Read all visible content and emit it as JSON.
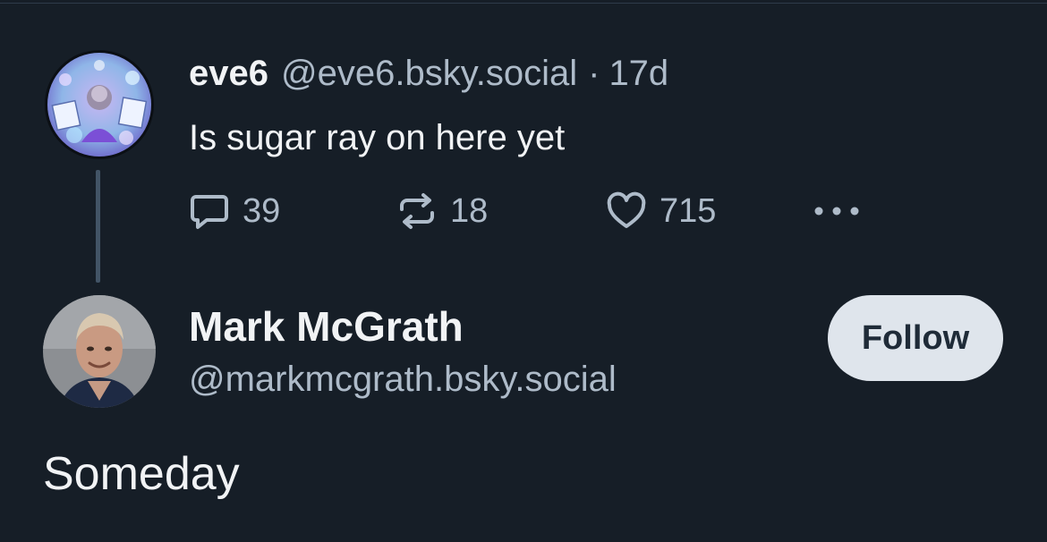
{
  "colors": {
    "background": "#161e27",
    "primary_text": "#f1f3f5",
    "secondary_text": "#aebbc9",
    "thread_line": "#425466",
    "follow_button_bg": "#dfe5ec",
    "follow_button_text": "#1f2b38"
  },
  "parent_post": {
    "author": {
      "display_name": "eve6",
      "handle": "@eve6.bsky.social",
      "avatar_icon": "eve6-avatar"
    },
    "separator": "·",
    "time": "17d",
    "text": "Is sugar ray on here yet",
    "actions": {
      "reply": {
        "icon": "reply-icon",
        "count": "39"
      },
      "repost": {
        "icon": "repost-icon",
        "count": "18"
      },
      "like": {
        "icon": "heart-icon",
        "count": "715"
      },
      "more": {
        "icon": "more-icon"
      }
    }
  },
  "main_post": {
    "author": {
      "display_name": "Mark McGrath",
      "handle": "@markmcgrath.bsky.social",
      "avatar_icon": "mark-mcgrath-avatar"
    },
    "follow_label": "Follow",
    "text": "Someday"
  }
}
